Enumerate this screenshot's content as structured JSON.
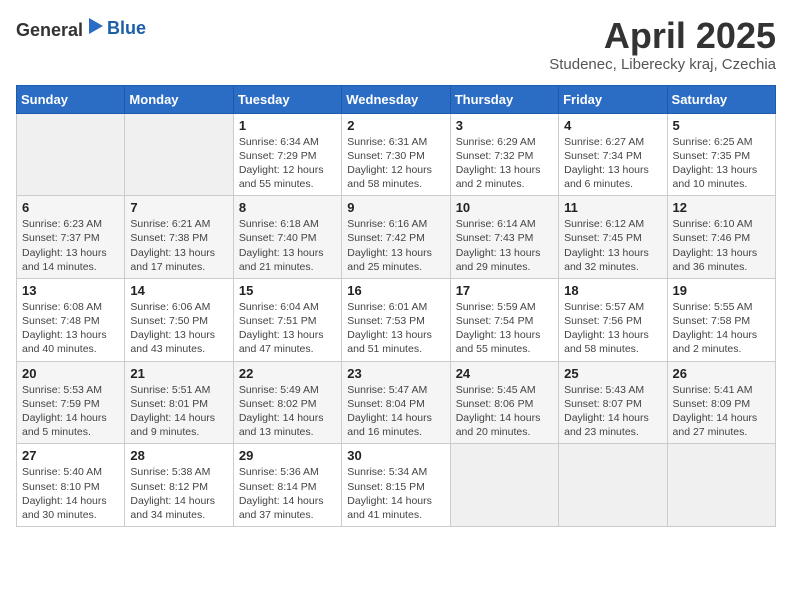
{
  "header": {
    "logo_general": "General",
    "logo_blue": "Blue",
    "month_title": "April 2025",
    "location": "Studenec, Liberecky kraj, Czechia"
  },
  "weekdays": [
    "Sunday",
    "Monday",
    "Tuesday",
    "Wednesday",
    "Thursday",
    "Friday",
    "Saturday"
  ],
  "weeks": [
    [
      {
        "day": "",
        "sunrise": "",
        "sunset": "",
        "daylight": ""
      },
      {
        "day": "",
        "sunrise": "",
        "sunset": "",
        "daylight": ""
      },
      {
        "day": "1",
        "sunrise": "Sunrise: 6:34 AM",
        "sunset": "Sunset: 7:29 PM",
        "daylight": "Daylight: 12 hours and 55 minutes."
      },
      {
        "day": "2",
        "sunrise": "Sunrise: 6:31 AM",
        "sunset": "Sunset: 7:30 PM",
        "daylight": "Daylight: 12 hours and 58 minutes."
      },
      {
        "day": "3",
        "sunrise": "Sunrise: 6:29 AM",
        "sunset": "Sunset: 7:32 PM",
        "daylight": "Daylight: 13 hours and 2 minutes."
      },
      {
        "day": "4",
        "sunrise": "Sunrise: 6:27 AM",
        "sunset": "Sunset: 7:34 PM",
        "daylight": "Daylight: 13 hours and 6 minutes."
      },
      {
        "day": "5",
        "sunrise": "Sunrise: 6:25 AM",
        "sunset": "Sunset: 7:35 PM",
        "daylight": "Daylight: 13 hours and 10 minutes."
      }
    ],
    [
      {
        "day": "6",
        "sunrise": "Sunrise: 6:23 AM",
        "sunset": "Sunset: 7:37 PM",
        "daylight": "Daylight: 13 hours and 14 minutes."
      },
      {
        "day": "7",
        "sunrise": "Sunrise: 6:21 AM",
        "sunset": "Sunset: 7:38 PM",
        "daylight": "Daylight: 13 hours and 17 minutes."
      },
      {
        "day": "8",
        "sunrise": "Sunrise: 6:18 AM",
        "sunset": "Sunset: 7:40 PM",
        "daylight": "Daylight: 13 hours and 21 minutes."
      },
      {
        "day": "9",
        "sunrise": "Sunrise: 6:16 AM",
        "sunset": "Sunset: 7:42 PM",
        "daylight": "Daylight: 13 hours and 25 minutes."
      },
      {
        "day": "10",
        "sunrise": "Sunrise: 6:14 AM",
        "sunset": "Sunset: 7:43 PM",
        "daylight": "Daylight: 13 hours and 29 minutes."
      },
      {
        "day": "11",
        "sunrise": "Sunrise: 6:12 AM",
        "sunset": "Sunset: 7:45 PM",
        "daylight": "Daylight: 13 hours and 32 minutes."
      },
      {
        "day": "12",
        "sunrise": "Sunrise: 6:10 AM",
        "sunset": "Sunset: 7:46 PM",
        "daylight": "Daylight: 13 hours and 36 minutes."
      }
    ],
    [
      {
        "day": "13",
        "sunrise": "Sunrise: 6:08 AM",
        "sunset": "Sunset: 7:48 PM",
        "daylight": "Daylight: 13 hours and 40 minutes."
      },
      {
        "day": "14",
        "sunrise": "Sunrise: 6:06 AM",
        "sunset": "Sunset: 7:50 PM",
        "daylight": "Daylight: 13 hours and 43 minutes."
      },
      {
        "day": "15",
        "sunrise": "Sunrise: 6:04 AM",
        "sunset": "Sunset: 7:51 PM",
        "daylight": "Daylight: 13 hours and 47 minutes."
      },
      {
        "day": "16",
        "sunrise": "Sunrise: 6:01 AM",
        "sunset": "Sunset: 7:53 PM",
        "daylight": "Daylight: 13 hours and 51 minutes."
      },
      {
        "day": "17",
        "sunrise": "Sunrise: 5:59 AM",
        "sunset": "Sunset: 7:54 PM",
        "daylight": "Daylight: 13 hours and 55 minutes."
      },
      {
        "day": "18",
        "sunrise": "Sunrise: 5:57 AM",
        "sunset": "Sunset: 7:56 PM",
        "daylight": "Daylight: 13 hours and 58 minutes."
      },
      {
        "day": "19",
        "sunrise": "Sunrise: 5:55 AM",
        "sunset": "Sunset: 7:58 PM",
        "daylight": "Daylight: 14 hours and 2 minutes."
      }
    ],
    [
      {
        "day": "20",
        "sunrise": "Sunrise: 5:53 AM",
        "sunset": "Sunset: 7:59 PM",
        "daylight": "Daylight: 14 hours and 5 minutes."
      },
      {
        "day": "21",
        "sunrise": "Sunrise: 5:51 AM",
        "sunset": "Sunset: 8:01 PM",
        "daylight": "Daylight: 14 hours and 9 minutes."
      },
      {
        "day": "22",
        "sunrise": "Sunrise: 5:49 AM",
        "sunset": "Sunset: 8:02 PM",
        "daylight": "Daylight: 14 hours and 13 minutes."
      },
      {
        "day": "23",
        "sunrise": "Sunrise: 5:47 AM",
        "sunset": "Sunset: 8:04 PM",
        "daylight": "Daylight: 14 hours and 16 minutes."
      },
      {
        "day": "24",
        "sunrise": "Sunrise: 5:45 AM",
        "sunset": "Sunset: 8:06 PM",
        "daylight": "Daylight: 14 hours and 20 minutes."
      },
      {
        "day": "25",
        "sunrise": "Sunrise: 5:43 AM",
        "sunset": "Sunset: 8:07 PM",
        "daylight": "Daylight: 14 hours and 23 minutes."
      },
      {
        "day": "26",
        "sunrise": "Sunrise: 5:41 AM",
        "sunset": "Sunset: 8:09 PM",
        "daylight": "Daylight: 14 hours and 27 minutes."
      }
    ],
    [
      {
        "day": "27",
        "sunrise": "Sunrise: 5:40 AM",
        "sunset": "Sunset: 8:10 PM",
        "daylight": "Daylight: 14 hours and 30 minutes."
      },
      {
        "day": "28",
        "sunrise": "Sunrise: 5:38 AM",
        "sunset": "Sunset: 8:12 PM",
        "daylight": "Daylight: 14 hours and 34 minutes."
      },
      {
        "day": "29",
        "sunrise": "Sunrise: 5:36 AM",
        "sunset": "Sunset: 8:14 PM",
        "daylight": "Daylight: 14 hours and 37 minutes."
      },
      {
        "day": "30",
        "sunrise": "Sunrise: 5:34 AM",
        "sunset": "Sunset: 8:15 PM",
        "daylight": "Daylight: 14 hours and 41 minutes."
      },
      {
        "day": "",
        "sunrise": "",
        "sunset": "",
        "daylight": ""
      },
      {
        "day": "",
        "sunrise": "",
        "sunset": "",
        "daylight": ""
      },
      {
        "day": "",
        "sunrise": "",
        "sunset": "",
        "daylight": ""
      }
    ]
  ]
}
